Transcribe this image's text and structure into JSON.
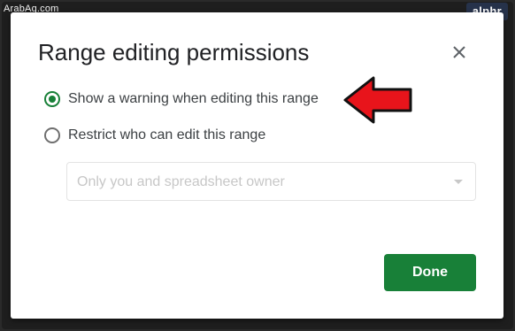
{
  "watermark": {
    "site": "ArabAq.com",
    "logo": "alphr"
  },
  "dialog": {
    "title": "Range editing permissions",
    "close_icon": "close-icon",
    "options": [
      {
        "label": "Show a warning when editing this range",
        "selected": true
      },
      {
        "label": "Restrict who can edit this range",
        "selected": false
      }
    ],
    "select": {
      "value": "Only you and spreadsheet owner",
      "disabled": true
    },
    "done_label": "Done"
  },
  "colors": {
    "accent": "#188038",
    "arrow": "#e8141b",
    "text": "#3c4043",
    "disabled_text": "#c7c7c7"
  }
}
